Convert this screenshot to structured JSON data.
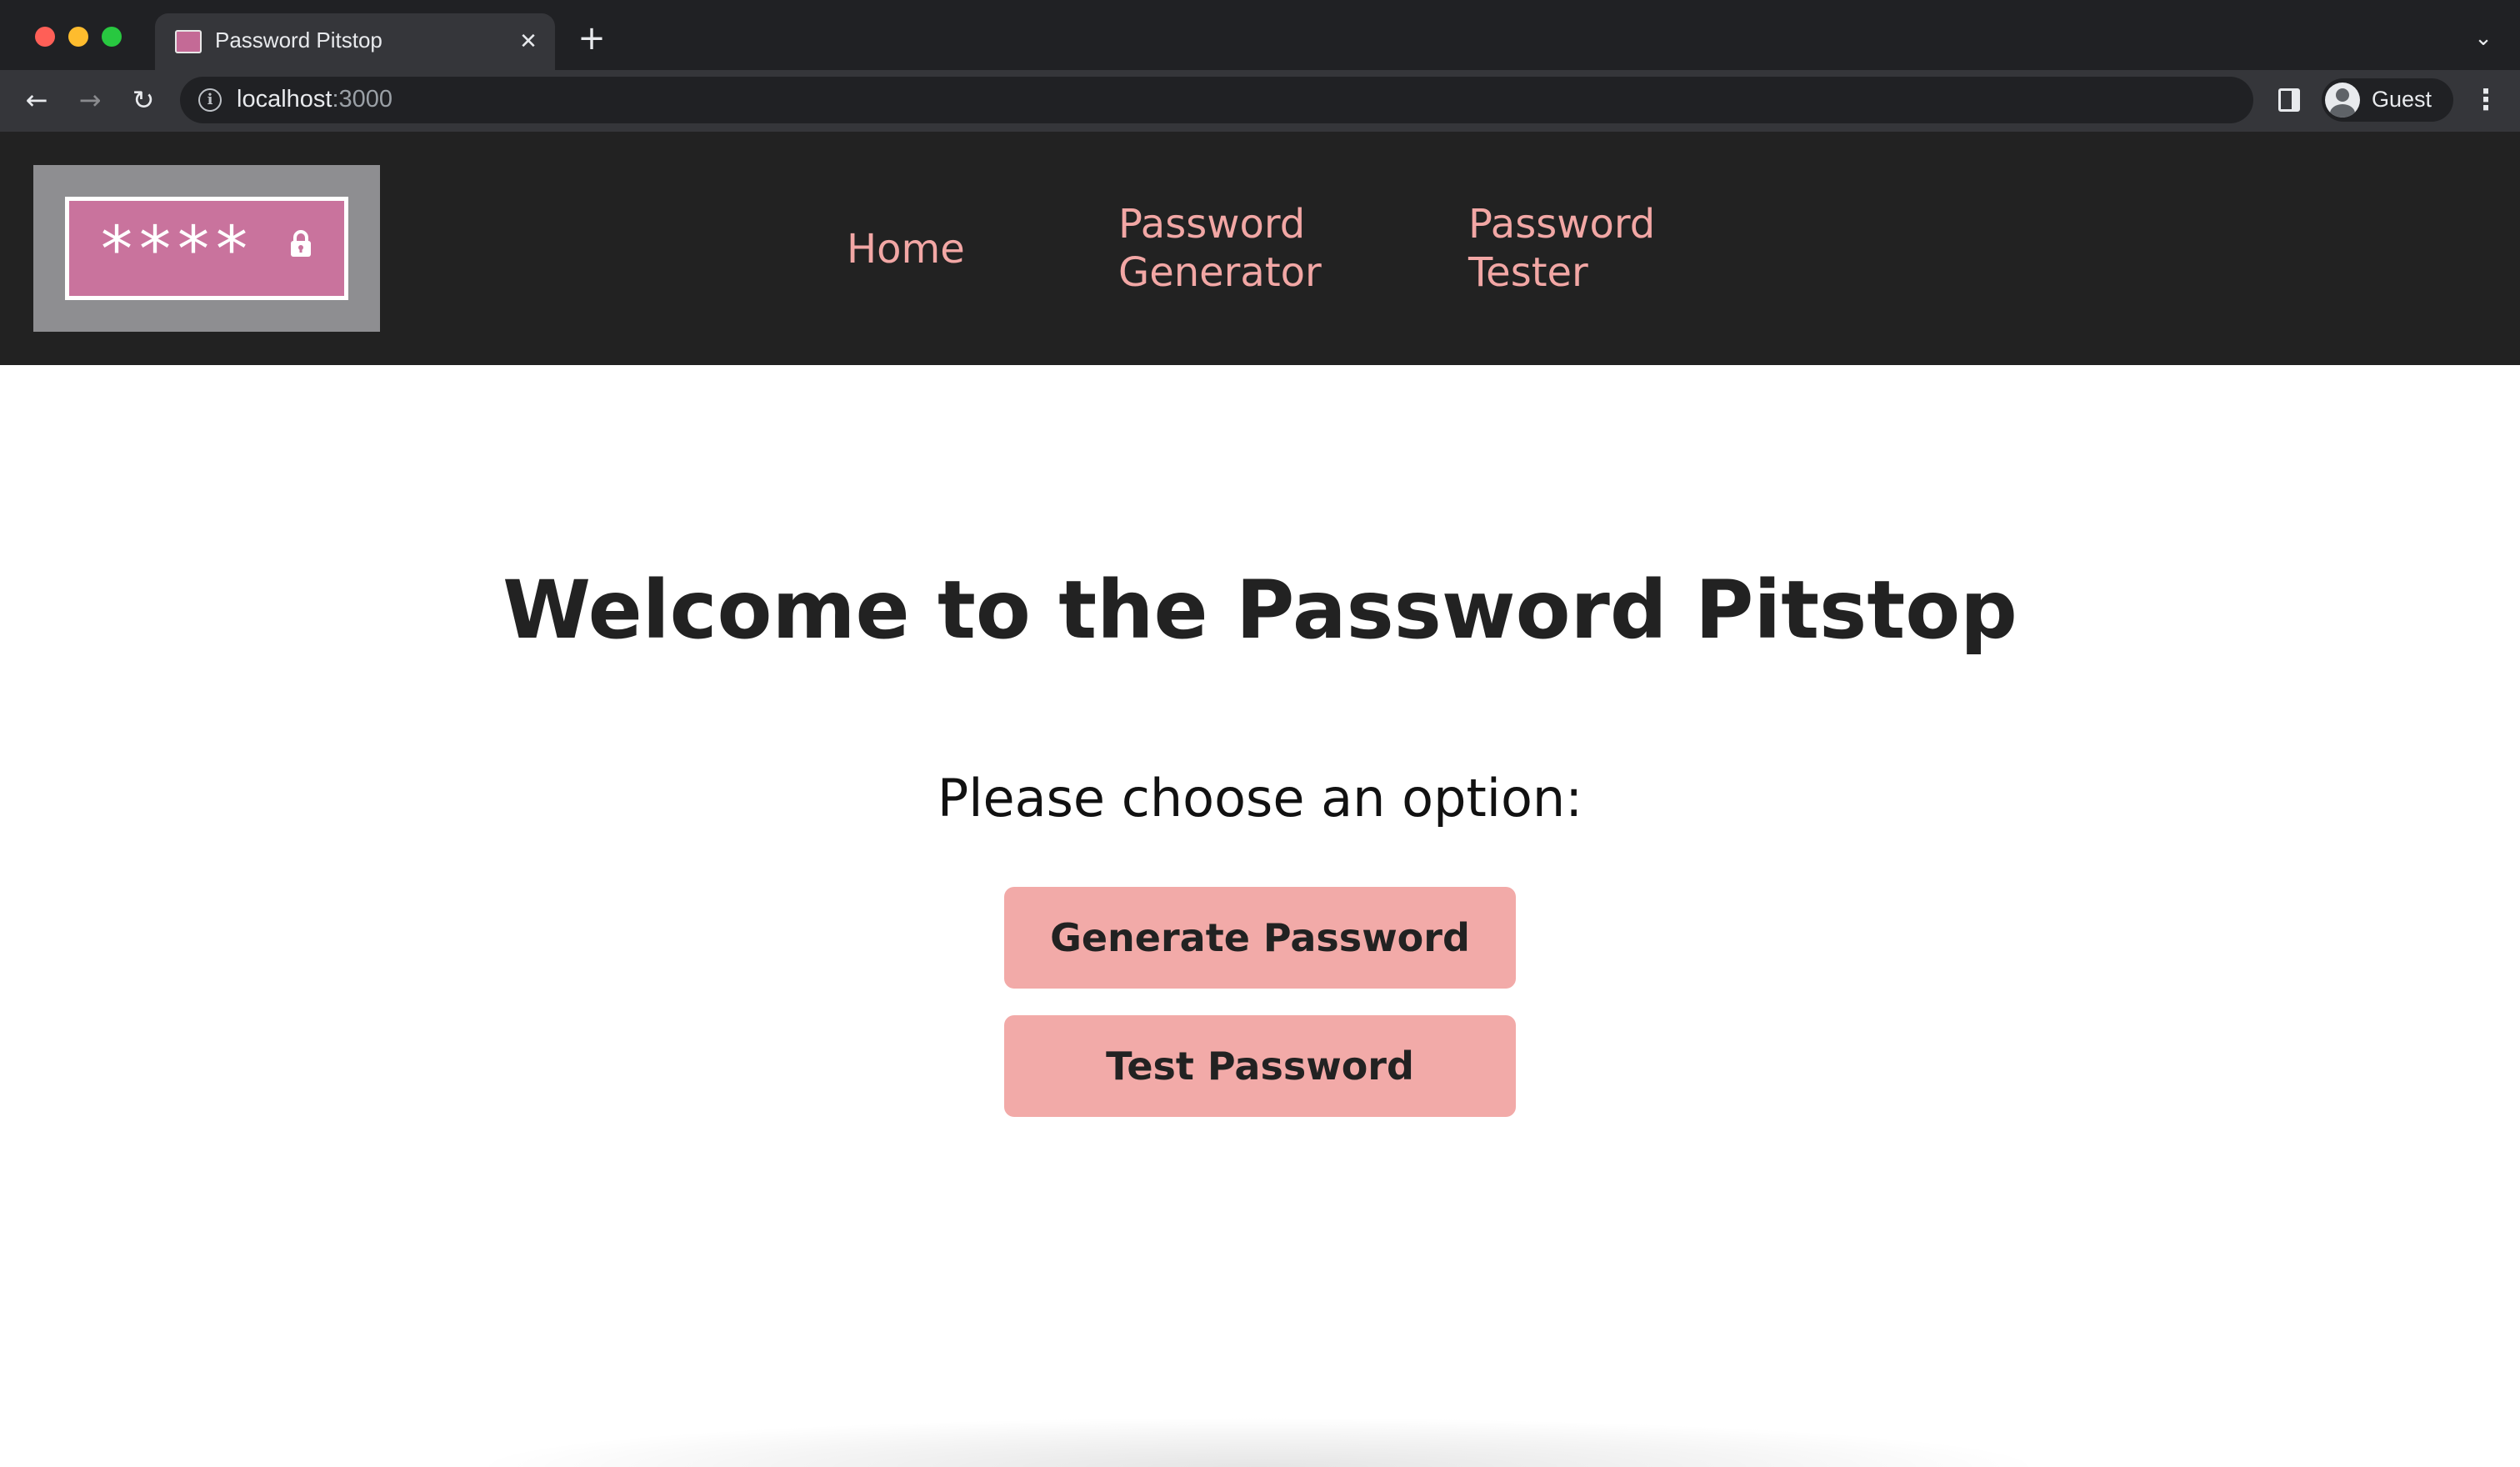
{
  "browser": {
    "tab_title": "Password Pitstop",
    "tab_close_glyph": "✕",
    "new_tab_glyph": "+",
    "tab_dropdown_glyph": "⌄",
    "back_glyph": "←",
    "forward_glyph": "→",
    "reload_glyph": "↻",
    "info_glyph": "i",
    "url_host": "localhost",
    "url_port": ":3000",
    "profile_label": "Guest",
    "menu_glyph": "⋮"
  },
  "header": {
    "logo_text": "****",
    "nav": {
      "home": "Home",
      "generator": "Password Generator",
      "tester": "Password Tester"
    }
  },
  "main": {
    "title": "Welcome to the Password Pitstop",
    "prompt": "Please choose an option:",
    "generate_button": "Generate Password",
    "test_button": "Test Password"
  },
  "colors": {
    "header_bg": "#222222",
    "nav_link": "#f2a7a5",
    "button_bg": "#f2aaa8",
    "logo_pink": "#c9739d",
    "logo_frame": "#8e8e91"
  },
  "icons": {
    "tab_favicon": "password-pitstop-favicon",
    "logo_lock": "lock-icon",
    "side_panel": "side-panel-icon",
    "profile": "guest-avatar-icon"
  }
}
